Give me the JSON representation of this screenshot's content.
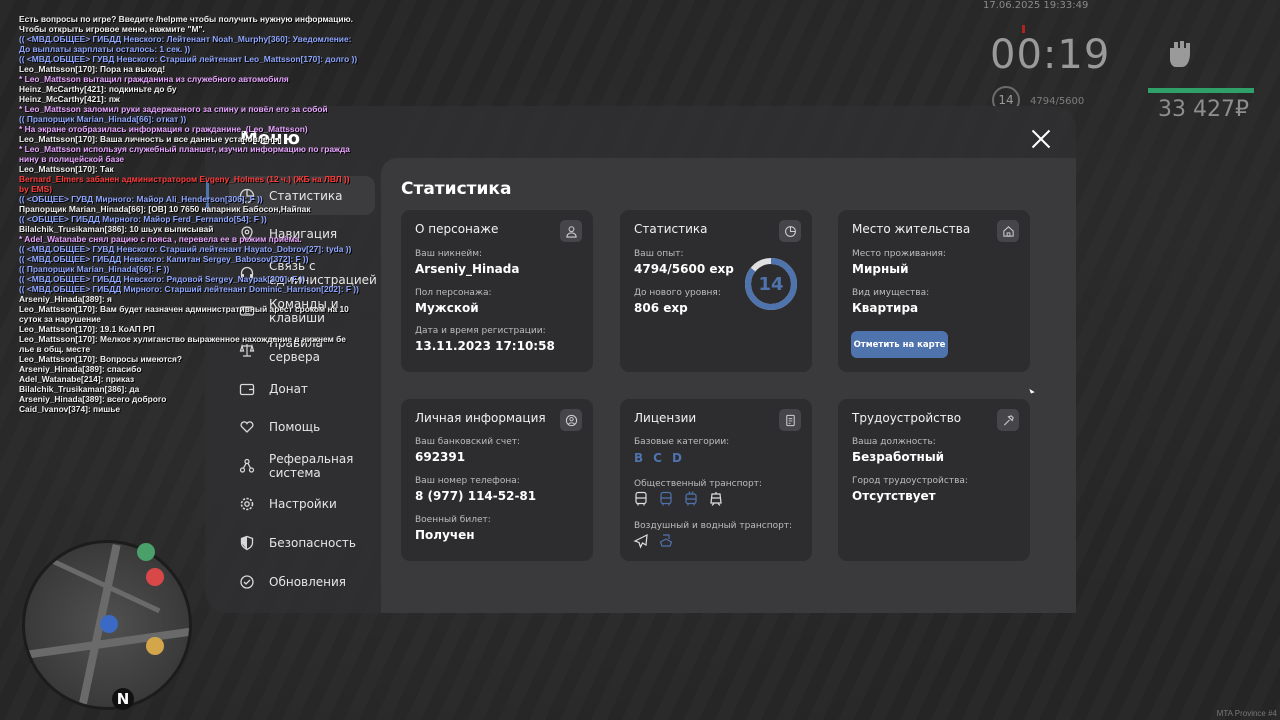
{
  "hud": {
    "datetime": "17.06.2025 19:33:49",
    "time": "00:19",
    "level": "14",
    "exp": "4794/5600",
    "health_color": "#2fa06a",
    "money": "33 427₽"
  },
  "chat": [
    {
      "text": "Есть вопросы по игре? Введите /helpme чтобы получить нужную информацию.",
      "color": "#f0f0f0"
    },
    {
      "text": "Чтобы открыть игровое меню, нажмите \"M\".",
      "color": "#f0f0f0"
    },
    {
      "text": "(( <МВД.ОБЩЕЕ> ГИБДД Невского: Лейтенант Noah_Murphy[360]: Уведомление:",
      "color": "#8fa6ff"
    },
    {
      "text": " До выплаты зарплаты осталось: 1 сек. ))",
      "color": "#8fa6ff"
    },
    {
      "text": "(( <МВД.ОБЩЕЕ> ГУВД Невского: Старший лейтенант Leo_Mattsson[170]: долго ))",
      "color": "#8fa6ff"
    },
    {
      "text": "Leo_Mattsson[170]: Пора на выход!",
      "color": "#f0f0f0"
    },
    {
      "text": " * Leo_Mattsson вытащил гражданина из служебного автомобиля",
      "color": "#e7a4ff"
    },
    {
      "text": "Heinz_McCarthy[421]: подкиньте до бу",
      "color": "#f0f0f0"
    },
    {
      "text": "Heinz_McCarthy[421]: пж",
      "color": "#f0f0f0"
    },
    {
      "text": " * Leo_Mattsson заломил руки задержанного за спину и повёл его за собой",
      "color": "#e7a4ff"
    },
    {
      "text": "(( Прапорщик Marian_Hinada[66]: откат ))",
      "color": "#8fa6ff"
    },
    {
      "text": " * На экране отобразилась информация о гражданине. (Leo_Mattsson)",
      "color": "#e7a4ff"
    },
    {
      "text": "Leo_Mattsson[170]: Ваша личность и все данные установлены",
      "color": "#f0f0f0"
    },
    {
      "text": " * Leo_Mattsson используя служебный планшет, изучил информацию по гражда",
      "color": "#e7a4ff"
    },
    {
      "text": "нину в полицейской базе",
      "color": "#e7a4ff"
    },
    {
      "text": "Leo_Mattsson[170]: Так",
      "color": "#f0f0f0"
    },
    {
      "text": "Bernard_Elmers забанен администратором Evgeny_Holmes (12 ч.) (ЖБ на ЛВЛ ))",
      "color": "#ff3b3b"
    },
    {
      "text": " by EMS)",
      "color": "#ff3b3b"
    },
    {
      "text": "(( <ОБЩЕЕ> ГУВД Мирного: Майор Ali_Henderson[306]: F ))",
      "color": "#8fa6ff"
    },
    {
      "text": "Прапорщик Marian_Hinada[66]: [ОВ] 10 7650 напарник Бабосон,Найпак",
      "color": "#f0f0f0"
    },
    {
      "text": "(( <ОБЩЕЕ> ГИБДД Мирного: Майор Ferd_Fernando[54]: F ))",
      "color": "#8fa6ff"
    },
    {
      "text": "Bilalchik_Trusikaman[386]: 10 шьук выписывай",
      "color": "#f0f0f0"
    },
    {
      "text": " * Adel_Watanabe снял рацию с пояса , перевела ее в режим приёма.",
      "color": "#e7a4ff"
    },
    {
      "text": "(( <МВД.ОБЩЕЕ> ГУВД Невского: Старший лейтенант Hayato_Dobrov[27]: tyda ))",
      "color": "#8fa6ff"
    },
    {
      "text": "(( <МВД.ОБЩЕЕ> ГИБДД Невского: Капитан Sergey_Babosov[372]: F ))",
      "color": "#8fa6ff"
    },
    {
      "text": "(( Прапорщик Marian_Hinada[66]: F ))",
      "color": "#8fa6ff"
    },
    {
      "text": "(( <МВД.ОБЩЕЕ> ГИБДД Невского: Рядовой Sergey_Naypak[300]: F ))",
      "color": "#8fa6ff"
    },
    {
      "text": "(( <МВД.ОБЩЕЕ> ГИБДД Мирного: Старший лейтенант Dominic_Harrison[202]: F ))",
      "color": "#8fa6ff"
    },
    {
      "text": "Arseniy_Hinada[389]: я",
      "color": "#f0f0f0"
    },
    {
      "text": "Leo_Mattsson[170]: Вам будет назначен административный арест сроком на 10",
      "color": "#f0f0f0"
    },
    {
      "text": " суток за нарушение",
      "color": "#f0f0f0"
    },
    {
      "text": "Leo_Mattsson[170]: 19.1 КоАП РП",
      "color": "#f0f0f0"
    },
    {
      "text": "Leo_Mattsson[170]: Мелкое хулиганство выраженное нахождение в нижнем бе",
      "color": "#f0f0f0"
    },
    {
      "text": "лье в общ. месте",
      "color": "#f0f0f0"
    },
    {
      "text": "Leo_Mattsson[170]: Вопросы имеются?",
      "color": "#f0f0f0"
    },
    {
      "text": "Arseniy_Hinada[389]: спасибо",
      "color": "#f0f0f0"
    },
    {
      "text": "Adel_Watanabe[214]: приказ",
      "color": "#f0f0f0"
    },
    {
      "text": "Bilalchik_Trusikaman[386]: да",
      "color": "#f0f0f0"
    },
    {
      "text": "Arseniy_Hinada[389]: всего доброго",
      "color": "#f0f0f0"
    },
    {
      "text": "Caid_Ivanov[374]: пишье",
      "color": "#f0f0f0"
    }
  ],
  "minimap": {
    "north_label": "N"
  },
  "watermark": "MTA Province #4",
  "menu": {
    "title": "Меню",
    "nav": [
      {
        "label": "Статистика",
        "icon": "pie-chart-icon",
        "active": true
      },
      {
        "label": "Навигация",
        "icon": "map-pin-icon"
      },
      {
        "label": "Связь с администрацией",
        "icon": "headset-icon"
      },
      {
        "label": "Команды и клавиши",
        "icon": "keyboard-icon"
      },
      {
        "label": "Правила сервера",
        "icon": "scales-icon"
      },
      {
        "label": "Донат",
        "icon": "wallet-icon"
      },
      {
        "label": "Помощь",
        "icon": "heart-hand-icon"
      },
      {
        "label": "Реферальная система",
        "icon": "network-icon"
      },
      {
        "label": "Настройки",
        "icon": "gear-icon"
      },
      {
        "label": "Безопасность",
        "icon": "shield-icon"
      },
      {
        "label": "Обновления",
        "icon": "refresh-icon"
      }
    ]
  },
  "stats": {
    "title": "Статистика",
    "accent_color": "#4f73ad",
    "character": {
      "title": "О персонаже",
      "nickname_label": "Ваш никнейм:",
      "nickname": "Arseniy_Hinada",
      "gender_label": "Пол персонажа:",
      "gender": "Мужской",
      "reg_label": "Дата и время регистрации:",
      "reg": "13.11.2023 17:10:58"
    },
    "experience": {
      "title": "Статистика",
      "exp_label": "Ваш опыт:",
      "exp": "4794/5600 exp",
      "next_label": "До нового уровня:",
      "next": "806 exp",
      "level": "14",
      "progress": 0.856
    },
    "residence": {
      "title": "Место жительства",
      "place_label": "Место проживания:",
      "place": "Мирный",
      "type_label": "Вид имущества:",
      "type": "Квартира",
      "button": "Отметить на карте"
    },
    "personal": {
      "title": "Личная информация",
      "bank_label": "Ваш банковский счет:",
      "bank": "692391",
      "phone_label": "Ваш номер телефона:",
      "phone": "8 (977) 114-52-81",
      "military_label": "Военный билет:",
      "military": "Получен"
    },
    "licenses": {
      "title": "Лицензии",
      "base_label": "Базовые категории:",
      "base": [
        "B",
        "C",
        "D"
      ],
      "public_label": "Общественный транспорт:",
      "public_icons": [
        "bus-icon",
        "bus-icon",
        "trolleybus-icon",
        "tram-icon"
      ],
      "air_label": "Воздушный и водный транспорт:",
      "air_icons": [
        "plane-icon",
        "boat-icon"
      ]
    },
    "employment": {
      "title": "Трудоустройство",
      "position_label": "Ваша должность:",
      "position": "Безработный",
      "city_label": "Город трудоустройства:",
      "city": "Отсутствует"
    }
  }
}
